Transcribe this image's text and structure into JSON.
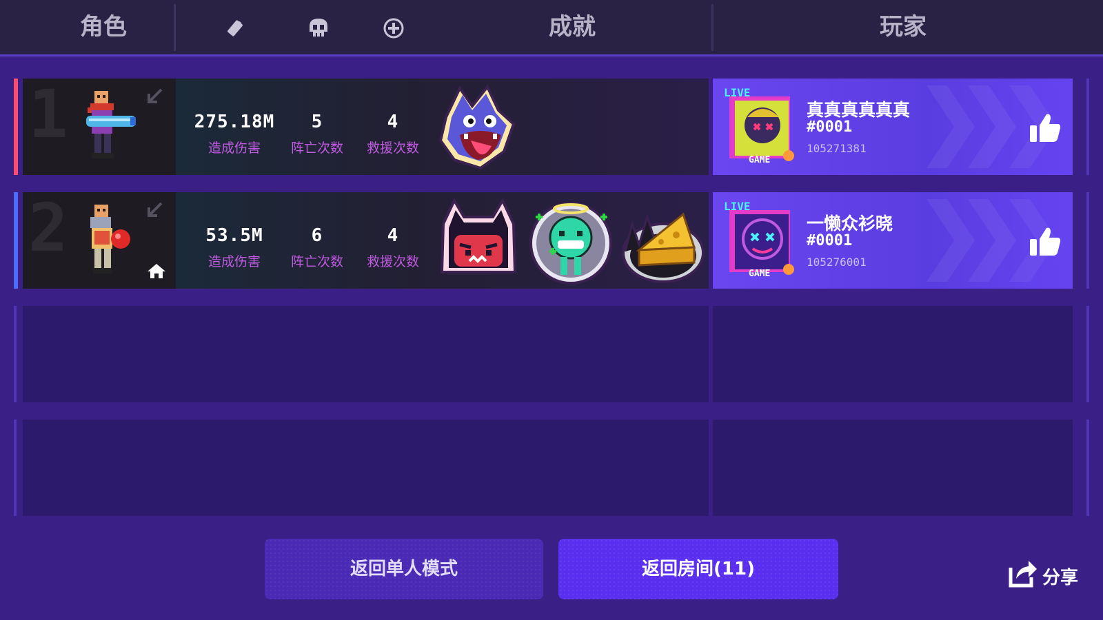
{
  "header": {
    "tab_character": "角色",
    "tab_achievements": "成就",
    "tab_players": "玩家",
    "icons": [
      "bullet-icon",
      "skull-icon",
      "crosshair-plus-icon"
    ]
  },
  "rows": [
    {
      "rank": "1",
      "accent_color": "#ff4d6d",
      "is_host": false,
      "stats": [
        {
          "value": "275.18M",
          "label": "造成伤害"
        },
        {
          "value": "5",
          "label": "阵亡次数"
        },
        {
          "value": "4",
          "label": "救援次数"
        }
      ],
      "badges": [
        "wolf-badge"
      ],
      "player": {
        "name": "真真真真真真",
        "tag": "#0001",
        "id": "105271381"
      }
    },
    {
      "rank": "2",
      "accent_color": "#4d6dff",
      "is_host": true,
      "stats": [
        {
          "value": "53.5M",
          "label": "造成伤害"
        },
        {
          "value": "6",
          "label": "阵亡次数"
        },
        {
          "value": "4",
          "label": "救援次数"
        }
      ],
      "badges": [
        "demon-badge",
        "angel-blob-badge",
        "cheese-badge"
      ],
      "player": {
        "name": "一懒众衫晓",
        "tag": "#0001",
        "id": "105276001"
      }
    }
  ],
  "buttons": {
    "return_solo": "返回单人模式",
    "return_room": "返回房间(11)",
    "share": "分享"
  },
  "colors": {
    "background": "#3a1f86",
    "header": "#2a2245",
    "stat_label": "#c05ae0",
    "player_panel": "#6446ee"
  }
}
